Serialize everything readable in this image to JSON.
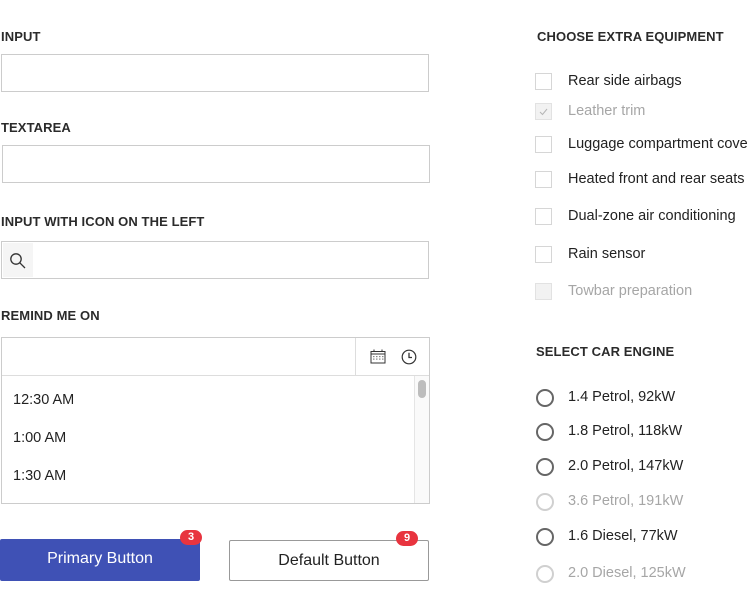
{
  "form": {
    "input": {
      "label": "INPUT",
      "value": "",
      "placeholder": ""
    },
    "textarea": {
      "label": "TEXTAREA",
      "value": "",
      "placeholder": ""
    },
    "icon_input": {
      "label": "INPUT WITH ICON ON THE LEFT",
      "icon": "search-icon",
      "value": "",
      "placeholder": ""
    },
    "remind": {
      "label": "REMIND ME ON",
      "value": "",
      "icons": [
        "calendar-icon",
        "clock-icon"
      ],
      "time_options": [
        "12:30 AM",
        "1:00 AM",
        "1:30 AM"
      ]
    }
  },
  "buttons": {
    "primary": {
      "label": "Primary Button",
      "badge": "3"
    },
    "default": {
      "label": "Default Button",
      "badge": "9"
    }
  },
  "equipment": {
    "title": "CHOOSE EXTRA EQUIPMENT",
    "items": [
      {
        "label": "Rear side airbags",
        "checked": false,
        "disabled": false
      },
      {
        "label": "Leather trim",
        "checked": true,
        "disabled": true
      },
      {
        "label": "Luggage compartment cove",
        "checked": false,
        "disabled": false
      },
      {
        "label": "Heated front and rear seats",
        "checked": false,
        "disabled": false
      },
      {
        "label": "Dual-zone air conditioning",
        "checked": false,
        "disabled": false
      },
      {
        "label": "Rain sensor",
        "checked": false,
        "disabled": false
      },
      {
        "label": "Towbar preparation",
        "checked": false,
        "disabled": true
      }
    ]
  },
  "engine": {
    "title": "SELECT CAR ENGINE",
    "options": [
      {
        "label": "1.4 Petrol, 92kW",
        "disabled": false
      },
      {
        "label": "1.8 Petrol, 118kW",
        "disabled": false
      },
      {
        "label": "2.0 Petrol, 147kW",
        "disabled": false
      },
      {
        "label": "3.6 Petrol, 191kW",
        "disabled": true
      },
      {
        "label": "1.6 Diesel, 77kW",
        "disabled": false
      },
      {
        "label": "2.0 Diesel, 125kW",
        "disabled": true
      }
    ]
  },
  "colors": {
    "primary": "#3f51b5",
    "badge": "#e8343f"
  }
}
